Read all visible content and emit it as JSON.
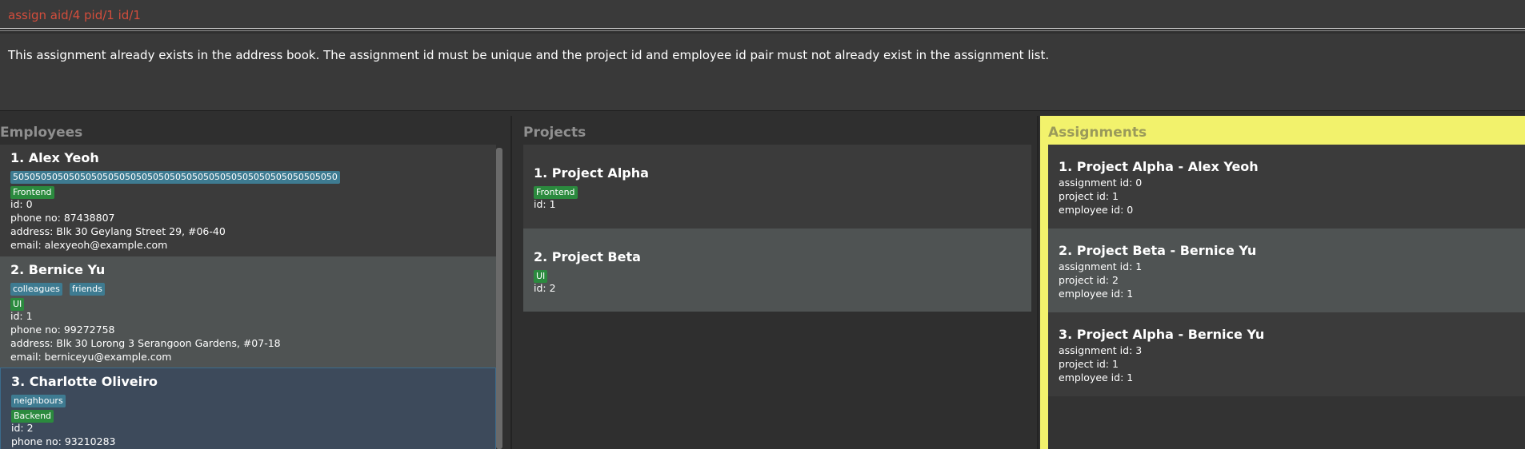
{
  "command": {
    "value": "assign aid/4 pid/1 id/1"
  },
  "result": {
    "message": "This assignment already exists in the address book. The assignment id must be unique and the project id and employee id pair must not already exist in the assignment list."
  },
  "employees": {
    "title": "Employees",
    "items": [
      {
        "name": "1. Alex Yeoh",
        "tags": [
          "5050505050505050505050505050505050505050505050505050505050"
        ],
        "departments": [
          "Frontend"
        ],
        "id": "id: 0",
        "phone": "phone no: 87438807",
        "address": "address: Blk 30 Geylang Street 29, #06-40",
        "email": "email: alexyeoh@example.com"
      },
      {
        "name": "2. Bernice Yu",
        "tags": [
          "colleagues",
          "friends"
        ],
        "departments": [
          "UI"
        ],
        "id": "id: 1",
        "phone": "phone no: 99272758",
        "address": "address: Blk 30 Lorong 3 Serangoon Gardens, #07-18",
        "email": "email: berniceyu@example.com"
      },
      {
        "name": "3. Charlotte Oliveiro",
        "tags": [
          "neighbours"
        ],
        "departments": [
          "Backend"
        ],
        "id": "id: 2",
        "phone": "phone no: 93210283"
      }
    ]
  },
  "projects": {
    "title": "Projects",
    "items": [
      {
        "name": "1. Project Alpha",
        "departments": [
          "Frontend"
        ],
        "id": "id: 1"
      },
      {
        "name": "2. Project Beta",
        "departments": [
          "UI"
        ],
        "id": "id: 2"
      }
    ]
  },
  "assignments": {
    "title": "Assignments",
    "items": [
      {
        "name": "1. Project Alpha - Alex Yeoh",
        "aid": "assignment id: 0",
        "pid": "project id: 1",
        "eid": "employee id: 0"
      },
      {
        "name": "2. Project Beta - Bernice Yu",
        "aid": "assignment id: 1",
        "pid": "project id: 2",
        "eid": "employee id: 1"
      },
      {
        "name": "3. Project Alpha - Bernice Yu",
        "aid": "assignment id: 3",
        "pid": "project id: 1",
        "eid": "employee id: 1"
      }
    ]
  },
  "colors": {
    "command_text": "#d24d3c",
    "tag": "#3e7b91",
    "department_tag": "#2b8a3e",
    "assignments_header": "#f2f26c",
    "selected_card": "#3d4a5b"
  }
}
